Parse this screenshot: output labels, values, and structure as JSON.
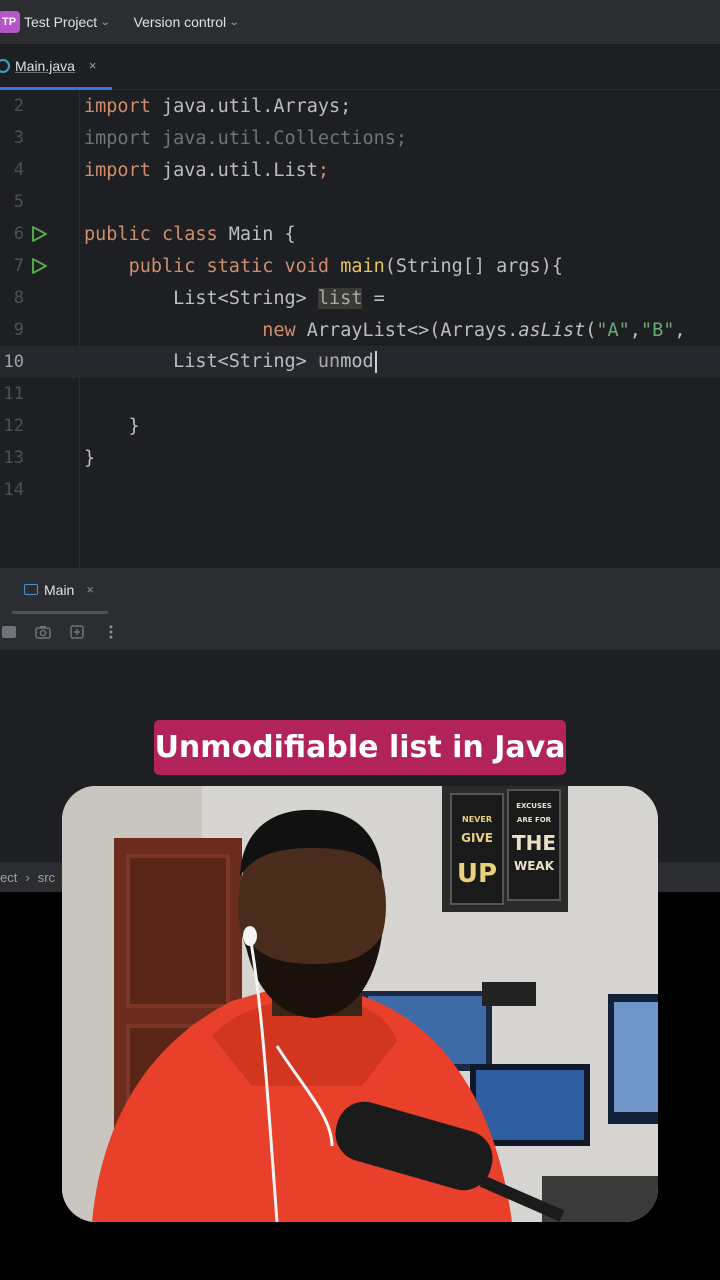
{
  "toolbar": {
    "project_badge": "TP",
    "project_name": "Test Project",
    "version_control": "Version control"
  },
  "editor_tab": {
    "label": "Main.java",
    "close": "×"
  },
  "code": {
    "lines": [
      {
        "num": "2",
        "text": "import java.util.Arrays;"
      },
      {
        "num": "3",
        "text": "import java.util.Collections;"
      },
      {
        "num": "4",
        "text": "import java.util.List;"
      },
      {
        "num": "5",
        "text": ""
      },
      {
        "num": "6",
        "text": "public class Main {"
      },
      {
        "num": "7",
        "text": "    public static void main(String[] args){"
      },
      {
        "num": "8",
        "text": "        List<String> list ="
      },
      {
        "num": "9",
        "text": "                new ArrayList<>(Arrays.asList(\"A\",\"B\","
      },
      {
        "num": "10",
        "text": "        List<String> unmod"
      },
      {
        "num": "11",
        "text": ""
      },
      {
        "num": "12",
        "text": "    }"
      },
      {
        "num": "13",
        "text": "}"
      },
      {
        "num": "14",
        "text": ""
      }
    ],
    "current_line": "10"
  },
  "run_panel": {
    "tab_label": "Main",
    "close": "×"
  },
  "breadcrumb": {
    "project": "ect",
    "folder": "src"
  },
  "caption": "Unmodifiable list in Java",
  "poster": {
    "left_line1": "NEVER",
    "left_line2": "GIVE",
    "left_line3": "UP",
    "right_line1": "EXCUSES",
    "right_line2": "ARE FOR",
    "right_line3": "THE",
    "right_line4": "WEAK"
  },
  "colors": {
    "keyword": "#cf8e6d",
    "method": "#e6c35c",
    "string": "#6aab73",
    "caption_bg": "#b3235b",
    "accent_blue": "#3574f0"
  }
}
